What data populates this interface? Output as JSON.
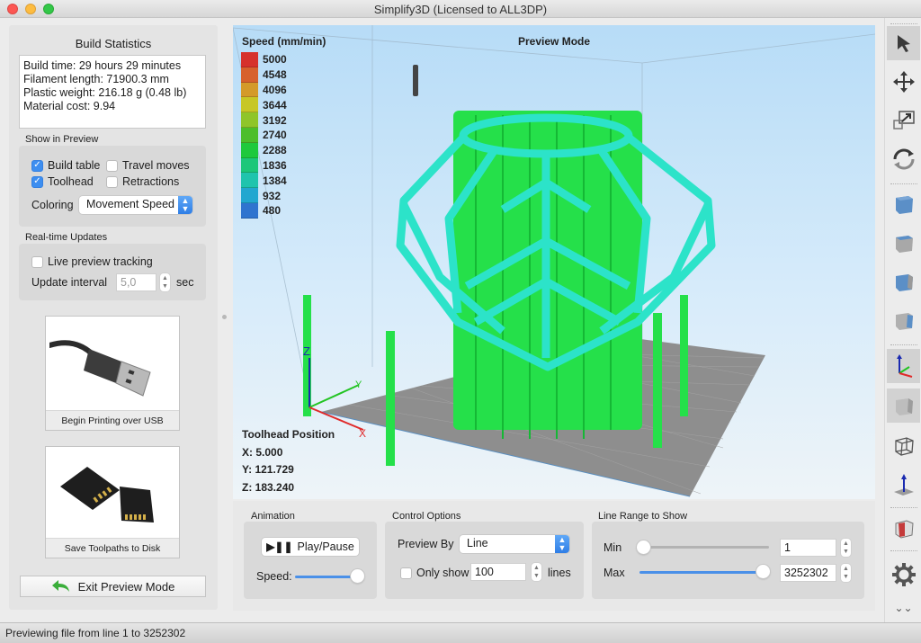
{
  "window": {
    "title": "Simplify3D (Licensed to ALL3DP)"
  },
  "left_panel": {
    "build_statistics": {
      "title": "Build Statistics",
      "lines": [
        "Build time: 29 hours 29 minutes",
        "Filament length: 71900.3 mm",
        "Plastic weight: 216.18 g (0.48 lb)",
        "Material cost: 9.94"
      ]
    },
    "show_in_preview": {
      "title": "Show in Preview",
      "checkboxes": [
        {
          "label": "Build table",
          "checked": true
        },
        {
          "label": "Travel moves",
          "checked": false
        },
        {
          "label": "Toolhead",
          "checked": true
        },
        {
          "label": "Retractions",
          "checked": false
        }
      ],
      "coloring_label": "Coloring",
      "coloring_value": "Movement Speed"
    },
    "realtime_updates": {
      "title": "Real-time Updates",
      "live_tracking_label": "Live preview tracking",
      "live_tracking_checked": false,
      "interval_label": "Update interval",
      "interval_value": "5,0",
      "interval_unit": "sec"
    },
    "usb_button_label": "Begin Printing over USB",
    "sd_button_label": "Save Toolpaths to Disk",
    "exit_button_label": "Exit Preview Mode"
  },
  "viewport": {
    "mode_title": "Preview Mode",
    "legend": {
      "title": "Speed (mm/min)",
      "entries": [
        {
          "value": "5000",
          "color": "#d6312c"
        },
        {
          "value": "4548",
          "color": "#d7612d"
        },
        {
          "value": "4096",
          "color": "#d49a2a"
        },
        {
          "value": "3644",
          "color": "#c7c726"
        },
        {
          "value": "3192",
          "color": "#8fc52a"
        },
        {
          "value": "2740",
          "color": "#4cbe2b"
        },
        {
          "value": "2288",
          "color": "#1ec93c"
        },
        {
          "value": "1836",
          "color": "#1cc77a"
        },
        {
          "value": "1384",
          "color": "#1fc4ad"
        },
        {
          "value": "932",
          "color": "#22a7d0"
        },
        {
          "value": "480",
          "color": "#2f74cf"
        }
      ]
    },
    "axes": {
      "x": "X",
      "y": "Y",
      "z": "Z"
    },
    "toolhead_position": {
      "title": "Toolhead Position",
      "x": "X: 5.000",
      "y": "Y: 121.729",
      "z": "Z: 183.240"
    }
  },
  "controls": {
    "animation": {
      "title": "Animation",
      "play_pause_label": "Play/Pause",
      "speed_label": "Speed:",
      "speed_fraction": 1.0
    },
    "control_options": {
      "title": "Control Options",
      "preview_by_label": "Preview By",
      "preview_by_value": "Line",
      "only_show_label": "Only show",
      "only_show_checked": false,
      "only_show_value": "100",
      "lines_label": "lines"
    },
    "line_range": {
      "title": "Line Range to Show",
      "min_label": "Min",
      "min_value": "1",
      "max_label": "Max",
      "max_value": "3252302"
    }
  },
  "toolbar": {
    "tools": [
      "select-tool",
      "move-tool",
      "scale-tool",
      "rotate-tool",
      "view-top",
      "view-front",
      "view-side",
      "view-right",
      "show-axes",
      "solid-view",
      "wireframe-view",
      "build-direction",
      "cross-section",
      "settings",
      "more"
    ]
  },
  "status_bar": {
    "text": "Previewing file from line 1 to 3252302"
  }
}
